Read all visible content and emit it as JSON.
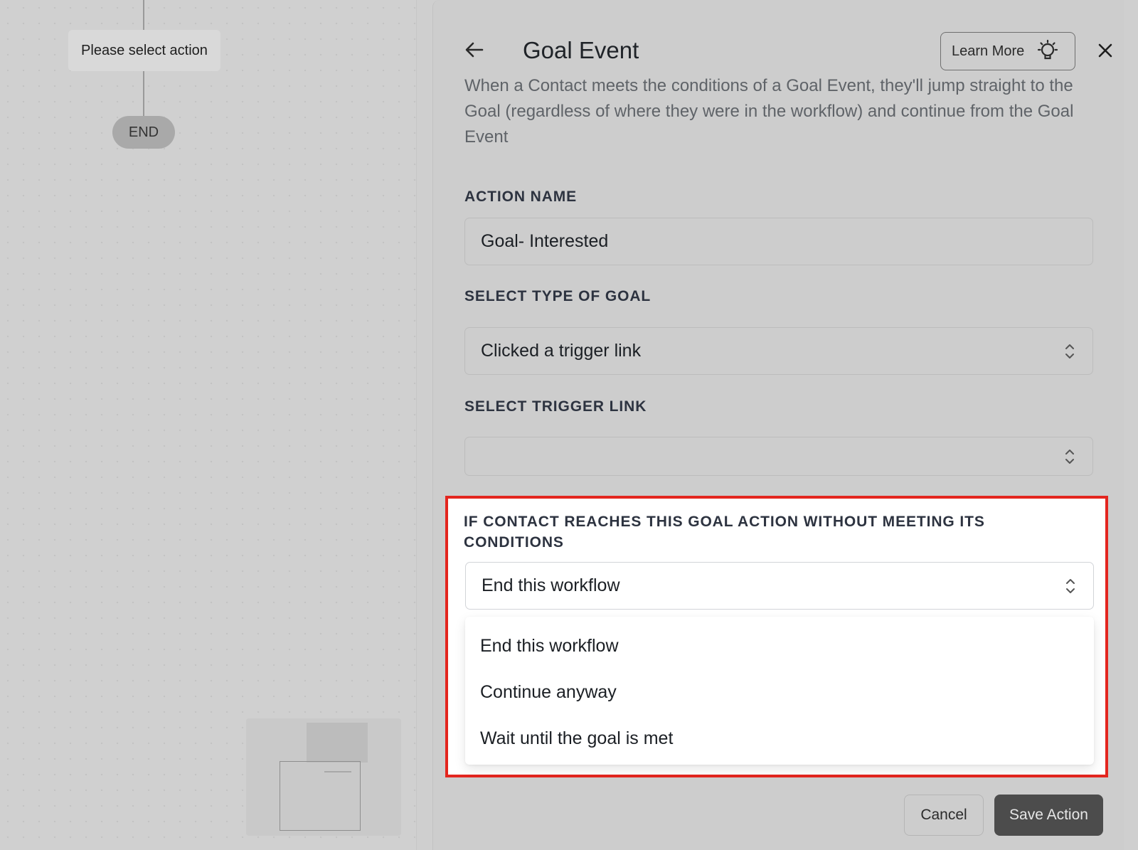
{
  "canvas": {
    "action_node_label": "Please select action",
    "end_node_label": "END"
  },
  "panel": {
    "title": "Goal Event",
    "learn_more_label": "Learn More",
    "description": "When a Contact meets the conditions of a Goal Event, they'll jump straight to the Goal (regardless of where they were in the workflow) and continue from the Goal Event",
    "action_name": {
      "label": "ACTION NAME",
      "value": "Goal- Interested"
    },
    "goal_type": {
      "label": "SELECT TYPE OF GOAL",
      "value": "Clicked a trigger link"
    },
    "trigger_link": {
      "label": "SELECT TRIGGER LINK",
      "value": ""
    },
    "fallback": {
      "label": "IF CONTACT REACHES THIS GOAL ACTION WITHOUT MEETING ITS CONDITIONS",
      "value": "End this workflow",
      "options": [
        "End this workflow",
        "Continue anyway",
        "Wait until the goal is met"
      ]
    },
    "buttons": {
      "cancel": "Cancel",
      "save": "Save Action"
    }
  },
  "colors": {
    "highlight_border": "#e3261f",
    "save_button": "#4c4c4c"
  },
  "icons": [
    "arrow-left-icon",
    "lightbulb-icon",
    "close-icon",
    "chevron-up-down-icon"
  ]
}
